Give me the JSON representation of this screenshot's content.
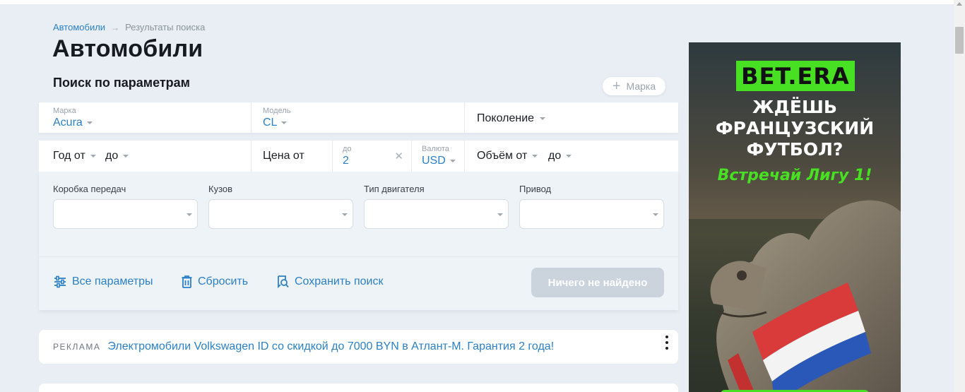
{
  "breadcrumb": {
    "link": "Автомобили",
    "separator": "→",
    "current": "Результаты поиска"
  },
  "page_title": "Автомобили",
  "section_title": "Поиск по параметрам",
  "add_brand_label": "Марка",
  "row1": {
    "brand": {
      "label": "Марка",
      "value": "Acura"
    },
    "model": {
      "label": "Модель",
      "value": "CL"
    },
    "generation": {
      "label": "Поколение"
    }
  },
  "row2": {
    "year_from": "Год от",
    "year_to": "до",
    "price_from": "Цена от",
    "price_to_label": "до",
    "price_to_value": "2",
    "currency_label": "Валюта",
    "currency_value": "USD",
    "volume_from": "Объём от",
    "volume_to": "до"
  },
  "selects": {
    "transmission": "Коробка передач",
    "body": "Кузов",
    "engine": "Тип двигателя",
    "drive": "Привод"
  },
  "actions": {
    "all_params": "Все параметры",
    "reset": "Сбросить",
    "save_search": "Сохранить поиск",
    "submit": "Ничего не найдено"
  },
  "ad": {
    "label": "РЕКЛАМА",
    "text": "Электромобили Volkswagen ID со скидкой до 7000 BYN в Атлант-М. Гарантия 2 года!"
  },
  "banner": {
    "logo": "BET.ERA",
    "headline": [
      "ЖДЁШЬ",
      "ФРАНЦУЗСКИЙ",
      "ФУТБОЛ?"
    ],
    "sub": "Встречай Лигу 1!"
  },
  "colors": {
    "accent": "#2b80c6",
    "page_bg": "#e9eef5",
    "banner_green": "#48e022",
    "button_disabled": "#cbd3dc"
  }
}
